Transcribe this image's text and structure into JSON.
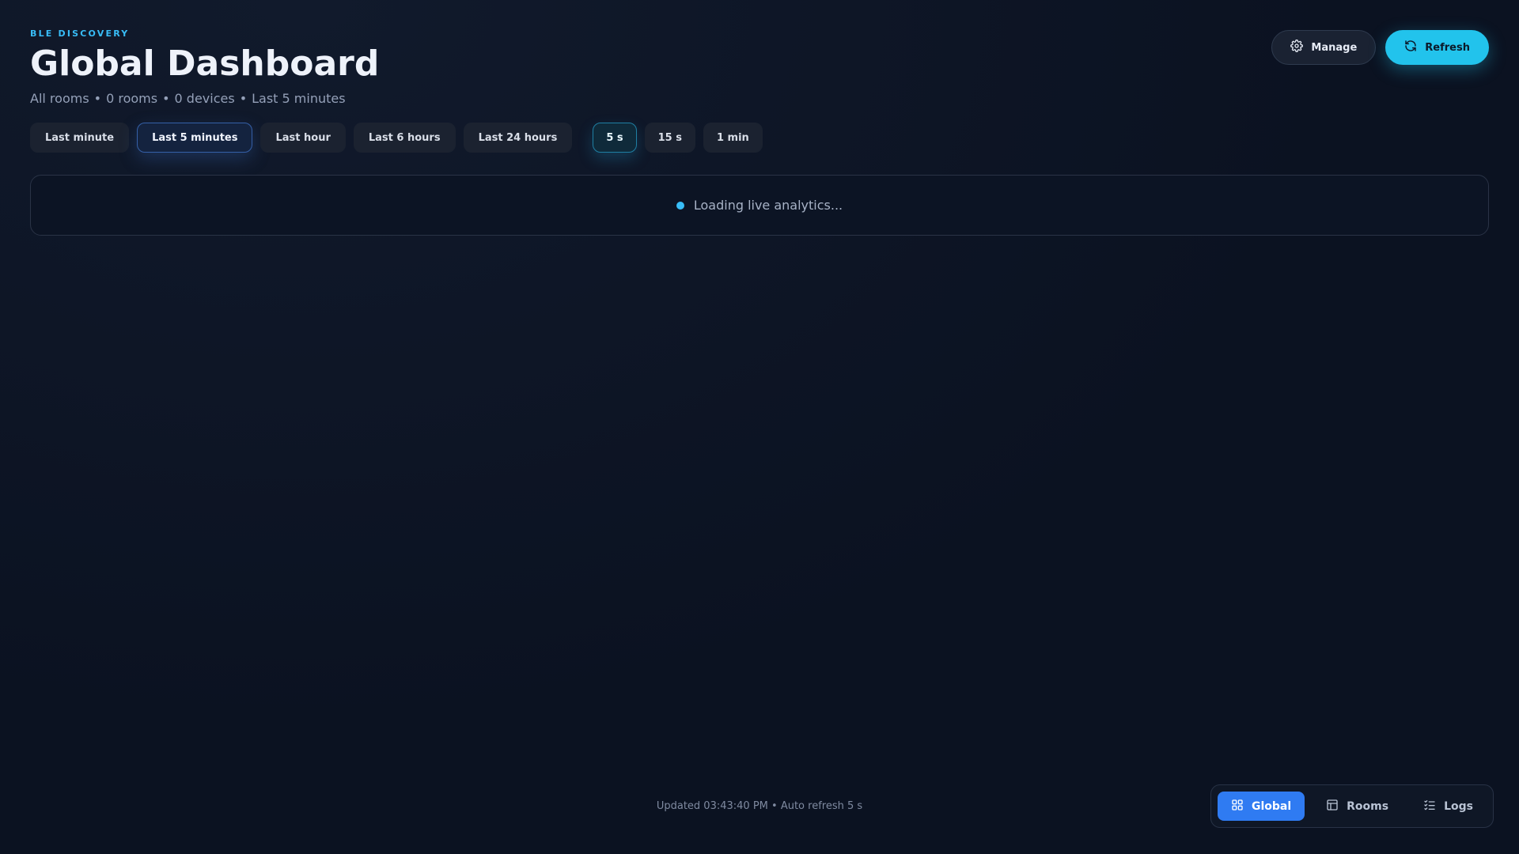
{
  "header": {
    "eyebrow": "BLE DISCOVERY",
    "title": "Global Dashboard",
    "subtitle_parts": [
      "All rooms",
      "0 rooms",
      "0 devices",
      "Last 5 minutes"
    ],
    "separator": "•"
  },
  "actions": {
    "manage_label": "Manage",
    "manage_icon": "gear-icon",
    "refresh_label": "Refresh",
    "refresh_icon": "refresh-icon"
  },
  "time_ranges": [
    {
      "label": "Last minute",
      "active": false
    },
    {
      "label": "Last 5 minutes",
      "active": true
    },
    {
      "label": "Last hour",
      "active": false
    },
    {
      "label": "Last 6 hours",
      "active": false
    },
    {
      "label": "Last 24 hours",
      "active": false
    }
  ],
  "refresh_rates": [
    {
      "label": "5 s",
      "active": true
    },
    {
      "label": "15 s",
      "active": false
    },
    {
      "label": "1 min",
      "active": false
    }
  ],
  "loading": {
    "text": "Loading live analytics..."
  },
  "footer": {
    "status": "Updated 03:43:40 PM • Auto refresh 5 s"
  },
  "nav": {
    "items": [
      {
        "label": "Global",
        "icon": "grid-icon",
        "active": true
      },
      {
        "label": "Rooms",
        "icon": "layout-icon",
        "active": false
      },
      {
        "label": "Logs",
        "icon": "checklist-icon",
        "active": false
      }
    ]
  },
  "colors": {
    "background": "#0b1221",
    "accent": "#22c3ec",
    "primary": "#2f7bf2"
  }
}
